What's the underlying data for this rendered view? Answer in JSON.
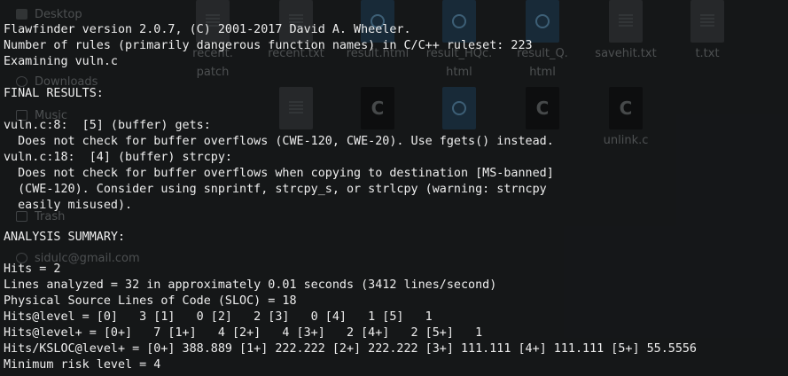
{
  "background_file_manager": {
    "sidebar": [
      {
        "label": "Desktop",
        "icon": "folder-icon"
      },
      {
        "label": "Downloads",
        "icon": "download-icon"
      },
      {
        "label": "Music",
        "icon": "music-icon"
      },
      {
        "label": "Trash",
        "icon": "trash-icon"
      },
      {
        "label": "sidulc@gmail.com",
        "icon": "account-icon"
      }
    ],
    "files": [
      {
        "name": "recent.\npatch",
        "kind": "txt"
      },
      {
        "name": "recent.txt",
        "kind": "txt"
      },
      {
        "name": "result.html",
        "kind": "html"
      },
      {
        "name": "result_HQc.\nhtml",
        "kind": "html"
      },
      {
        "name": "result_Q.\nhtml",
        "kind": "html"
      },
      {
        "name": "savehit.txt",
        "kind": "txt"
      },
      {
        "name": "t.txt",
        "kind": "txt"
      },
      {
        "name": "",
        "kind": "txt"
      },
      {
        "name": "",
        "kind": "c"
      },
      {
        "name": "",
        "kind": "html"
      },
      {
        "name": "",
        "kind": "c"
      },
      {
        "name": "unlink.c",
        "kind": "c"
      }
    ]
  },
  "terminal": {
    "lines": [
      "Flawfinder version 2.0.7, (C) 2001-2017 David A. Wheeler.",
      "Number of rules (primarily dangerous function names) in C/C++ ruleset: 223",
      "Examining vuln.c",
      "",
      "FINAL RESULTS:",
      "",
      "vuln.c:8:  [5] (buffer) gets:",
      "  Does not check for buffer overflows (CWE-120, CWE-20). Use fgets() instead.",
      "vuln.c:18:  [4] (buffer) strcpy:",
      "  Does not check for buffer overflows when copying to destination [MS-banned]",
      "  (CWE-120). Consider using snprintf, strcpy_s, or strlcpy (warning: strncpy",
      "  easily misused).",
      "",
      "ANALYSIS SUMMARY:",
      "",
      "Hits = 2",
      "Lines analyzed = 32 in approximately 0.01 seconds (3412 lines/second)",
      "Physical Source Lines of Code (SLOC) = 18",
      "Hits@level = [0]   3 [1]   0 [2]   2 [3]   0 [4]   1 [5]   1",
      "Hits@level+ = [0+]   7 [1+]   4 [2+]   4 [3+]   2 [4+]   2 [5+]   1",
      "Hits/KSLOC@level+ = [0+] 388.889 [1+] 222.222 [2+] 222.222 [3+] 111.111 [4+] 111.111 [5+] 55.5556",
      "Minimum risk level = 4"
    ]
  }
}
